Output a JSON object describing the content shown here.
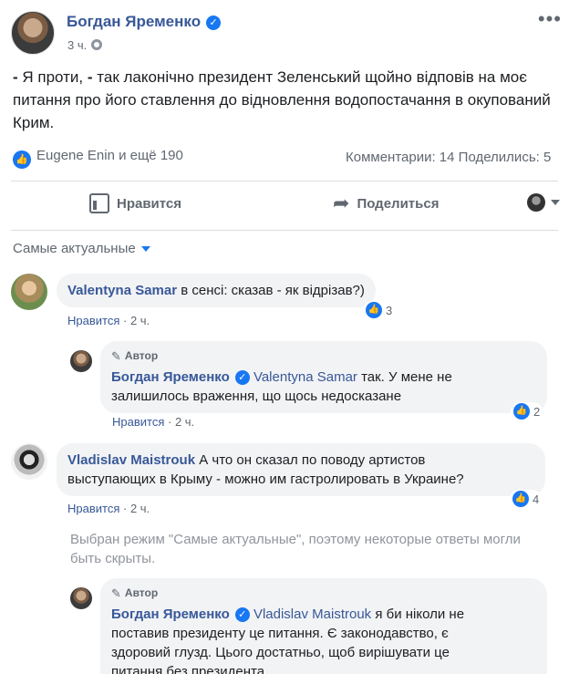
{
  "post": {
    "author": "Богдан Яременко",
    "time": "3 ч.",
    "text_line1_a": "- ",
    "text_line1_b": "Я проти, ",
    "text_line1_c": "- ",
    "text_line1_d": "так лаконічно президент Зеленський щойно відповів на моє",
    "text_line2": "питання про його ставлення до відновлення водопостачання в окупований",
    "text_line3": "Крим.",
    "reactions": "Eugene Enin и ещё 190",
    "stats": "Комментарии: 14  Поделились: 5",
    "like_label": "Нравится",
    "share_label": "Поделиться"
  },
  "sort": {
    "label": "Самые актуальные"
  },
  "comments": [
    {
      "name": "Valentyna Samar",
      "text": "в сенсі: сказав - як відрізав?)",
      "like_link": "Нравится",
      "time": "2 ч.",
      "reactions": "3",
      "reply": {
        "author_tag": "Автор",
        "name": "Богдан Яременко",
        "mention": "Valentyna Samar",
        "text_line1": "так. У мене не",
        "text_line2": "залишилось враження, що щось недосказане",
        "like_link": "Нравится",
        "time": "2 ч.",
        "reactions": "2"
      }
    },
    {
      "name": "Vladislav Maistrouk",
      "text_line1": "А что он сказал по поводу артистов",
      "text_line2": "выступающих в Крыму - можно им гастролировать в Украине?",
      "like_link": "Нравится",
      "time": "2 ч.",
      "reactions": "4",
      "note_line1": "Выбран режим \"Самые актуальные\", поэтому некоторые ответы могли",
      "note_line2": "быть скрыты.",
      "reply": {
        "author_tag": "Автор",
        "name": "Богдан Яременко",
        "mention": "Vladislav Maistrouk",
        "text_line1": "я би ніколи не",
        "text_line2": "поставив президенту це питання. Є законодавство, є",
        "text_line3": "здоровий глузд. Цього достатньо, щоб вирішувати це",
        "text_line4": "питання без президента"
      }
    }
  ]
}
